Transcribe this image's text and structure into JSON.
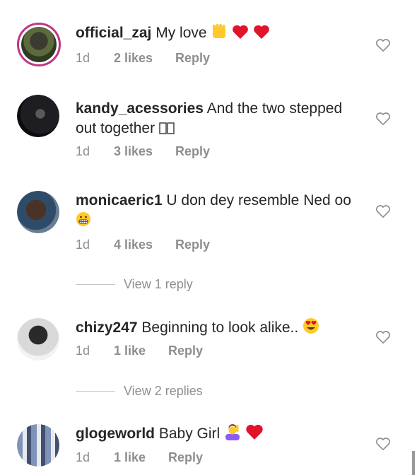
{
  "comments": [
    {
      "user": "official_zaj",
      "text": "My love",
      "time": "1d",
      "likes": "2 likes",
      "reply": "Reply"
    },
    {
      "user": "kandy_acessories",
      "text": "And the two stepped out together ",
      "time": "1d",
      "likes": "3 likes",
      "reply": "Reply"
    },
    {
      "user": "monicaeric1",
      "text": "U don dey resemble Ned oo",
      "time": "1d",
      "likes": "4 likes",
      "reply": "Reply",
      "view_replies": "View 1 reply"
    },
    {
      "user": "chizy247",
      "text": "Beginning to look alike..",
      "time": "1d",
      "likes": "1 like",
      "reply": "Reply",
      "view_replies": "View 2 replies"
    },
    {
      "user": "glogeworld",
      "text": "Baby Girl",
      "time": "1d",
      "likes": "1 like",
      "reply": "Reply"
    }
  ],
  "colors": {
    "username": "#262626",
    "meta": "#8e8e8e",
    "heart_emoji": "#e0142b",
    "story_ring": "#c13584"
  },
  "icons": [
    "heart-outline-icon",
    "raised-fist-emoji",
    "red-heart-emoji",
    "grimacing-emoji",
    "heart-eyes-emoji",
    "person-raising-hand-emoji"
  ]
}
